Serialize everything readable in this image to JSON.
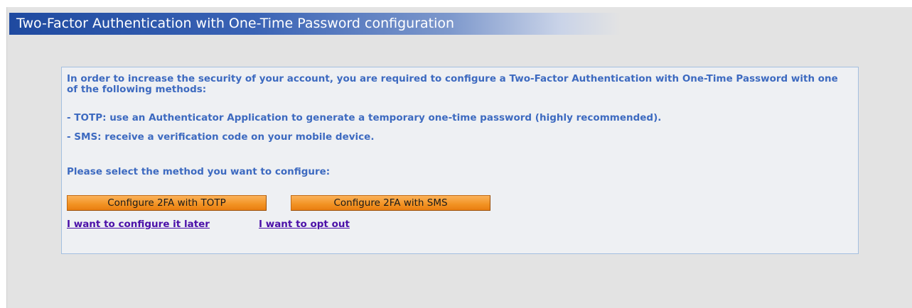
{
  "header": {
    "title": "Two-Factor Authentication with One-Time Password configuration"
  },
  "panel": {
    "intro": "In order to increase the security of your account, you are required to configure a Two-Factor Authentication with One-Time Password with one of the following methods:",
    "methods": [
      "- TOTP: use an Authenticator Application to generate a temporary one-time password (highly recommended).",
      "- SMS: receive a verification code on your mobile device."
    ],
    "select_prompt": "Please select the method you want to configure:",
    "buttons": {
      "totp": "Configure 2FA with TOTP",
      "sms": "Configure 2FA with SMS"
    },
    "links": {
      "later": "I want to configure it later",
      "opt_out": "I want to opt out"
    }
  },
  "colors": {
    "title_bar": "#1f4aa0",
    "text": "#3d6ac0",
    "button": "#f29222",
    "link": "#4a0fa8",
    "panel_border": "#a3bfe0"
  }
}
